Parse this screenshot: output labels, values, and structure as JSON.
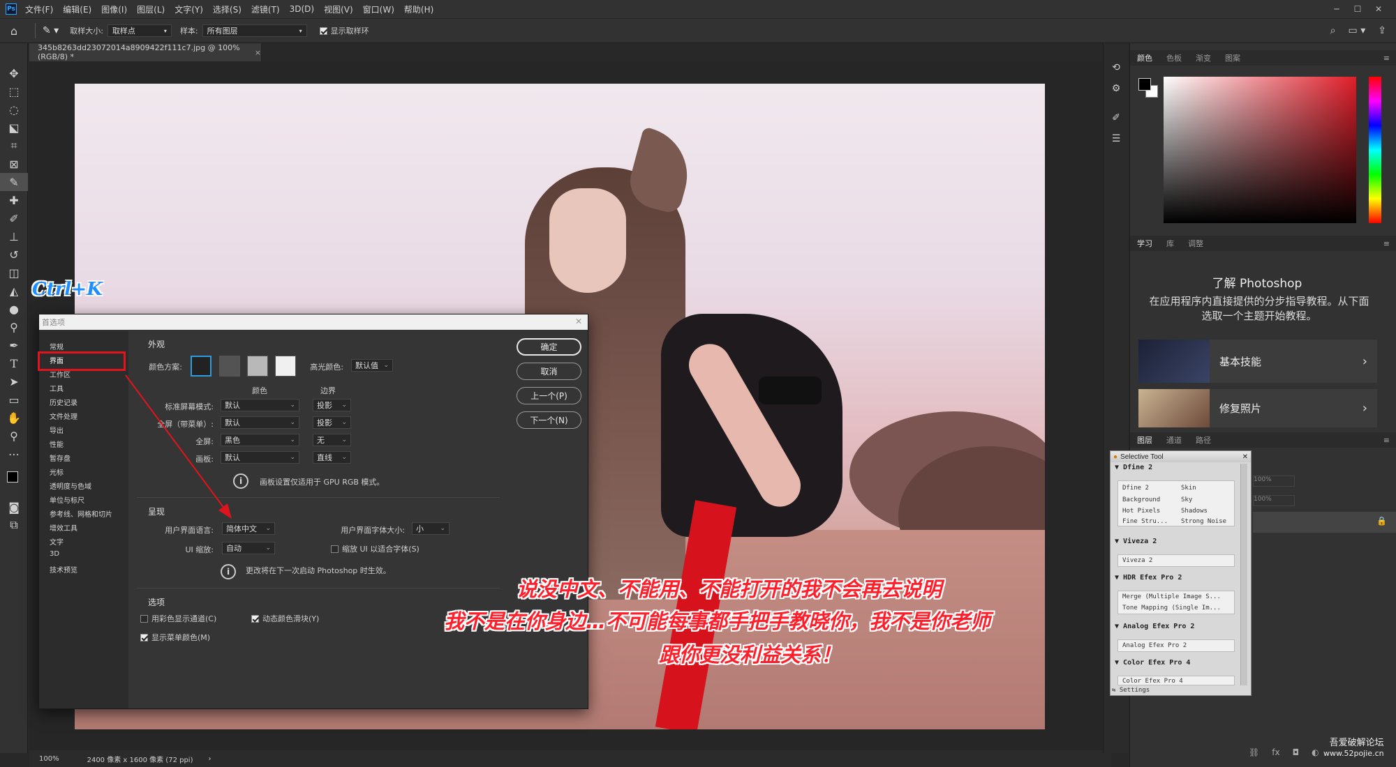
{
  "app": {
    "logo": "Ps"
  },
  "menubar": {
    "items": [
      "文件(F)",
      "编辑(E)",
      "图像(I)",
      "图层(L)",
      "文字(Y)",
      "选择(S)",
      "滤镜(T)",
      "3D(D)",
      "视图(V)",
      "窗口(W)",
      "帮助(H)"
    ]
  },
  "options_bar": {
    "sample_size_label": "取样大小:",
    "sample_size_value": "取样点",
    "sample_label": "样本:",
    "sample_value": "所有图层",
    "show_ring_label": "显示取样环"
  },
  "document_tab": {
    "title": "345b8263dd23072014a8909422f111c7.jpg @ 100%(RGB/8) *",
    "close": "×"
  },
  "status_bar": {
    "zoom": "100%",
    "info": "2400 像素 x 1600 像素 (72 ppi)",
    "arrow": "›"
  },
  "right_panel": {
    "color_tabs": [
      "颜色",
      "色板",
      "渐变",
      "图案"
    ],
    "learn_tabs": [
      "学习",
      "库",
      "调整"
    ],
    "learn_title": "了解 Photoshop",
    "learn_desc": "在应用程序内直接提供的分步指导教程。从下面选取一个主题开始教程。",
    "learn_cards": [
      {
        "label": "基本技能"
      },
      {
        "label": "修复照片"
      }
    ],
    "layer_tabs": [
      "图层",
      "通道",
      "路径"
    ],
    "opacity_value": "100%",
    "fill_value": "100%"
  },
  "dialog": {
    "title": "首选项",
    "nav_items": [
      "常规",
      "界面",
      "工作区",
      "工具",
      "历史记录",
      "文件处理",
      "导出",
      "性能",
      "暂存盘",
      "光标",
      "透明度与色域",
      "单位与标尺",
      "参考线、网格和切片",
      "增效工具",
      "文字",
      "3D",
      "技术预览"
    ],
    "appearance": {
      "section": "外观",
      "color_scheme_label": "颜色方案:",
      "highlight_label": "高光颜色:",
      "highlight_value": "默认值",
      "col_color": "颜色",
      "col_border": "边界",
      "rows": [
        {
          "label": "标准屏幕模式:",
          "color": "默认",
          "border": "投影"
        },
        {
          "label": "全屏（带菜单）:",
          "color": "默认",
          "border": "投影"
        },
        {
          "label": "全屏:",
          "color": "黑色",
          "border": "无"
        },
        {
          "label": "画板:",
          "color": "默认",
          "border": "直线"
        }
      ],
      "note": "画板设置仅适用于 GPU RGB 模式。"
    },
    "presentation": {
      "section": "呈现",
      "lang_label": "用户界面语言:",
      "lang_value": "简体中文",
      "font_size_label": "用户界面字体大小:",
      "font_size_value": "小",
      "scale_label": "UI 缩放:",
      "scale_value": "自动",
      "scale_fit_label": "缩放 UI 以适合字体(S)",
      "note": "更改将在下一次启动 Photoshop 时生效。"
    },
    "options": {
      "section": "选项",
      "color_channels": "用彩色显示通道(C)",
      "dynamic_sliders": "动态颜色滑块(Y)",
      "menu_colors": "显示菜单颜色(M)"
    },
    "buttons": {
      "ok": "确定",
      "cancel": "取消",
      "prev": "上一个(P)",
      "next": "下一个(N)"
    }
  },
  "selective_tool": {
    "title": "Selective Tool",
    "groups": [
      {
        "name": "Dfine 2",
        "cells": [
          "Dfine 2",
          "Skin",
          "Background",
          "Sky",
          "Hot Pixels",
          "Shadows",
          "Fine Stru...",
          "Strong Noise"
        ]
      },
      {
        "name": "Viveza 2",
        "cells": [
          "Viveza 2"
        ]
      },
      {
        "name": "HDR Efex Pro 2",
        "cells": [
          "Merge (Multiple Image S...",
          "Tone Mapping (Single Im..."
        ]
      },
      {
        "name": "Analog Efex Pro 2",
        "cells": [
          "Analog Efex Pro 2"
        ]
      },
      {
        "name": "Color Efex Pro 4",
        "cells": [
          "Color Efex Pro 4"
        ]
      }
    ],
    "settings": "Settings"
  },
  "overlay": {
    "shortcut": "Ctrl+K",
    "captions": [
      "说没中文、不能用、不能打开的我不会再去说明",
      "我不是在你身边…不可能每事都手把手教晓你，我不是你老师",
      "跟你更没利益关系！"
    ]
  },
  "watermark": {
    "line1": "吾爱破解论坛",
    "line2": "www.52pojie.cn"
  },
  "colors": {
    "accent": "#31a8ff",
    "highlight_red": "#e0141c",
    "caption_red": "#ff1f2a"
  }
}
